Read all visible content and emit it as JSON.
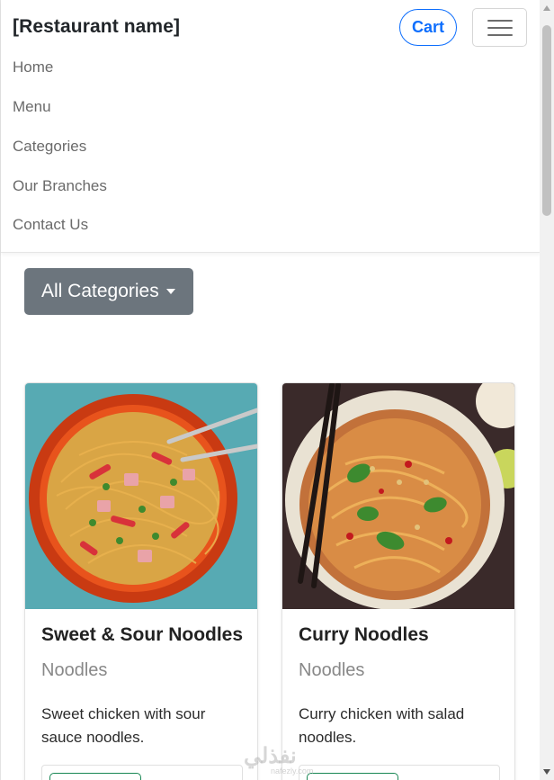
{
  "navbar": {
    "brand": "[Restaurant name]",
    "cart_label": "Cart",
    "toggler_icon": "hamburger-icon",
    "links": [
      "Home",
      "Menu",
      "Categories",
      "Our Branches",
      "Contact Us"
    ]
  },
  "filter": {
    "dropdown_label": "All Categories",
    "dropdown_icon": "caret-down-icon"
  },
  "products": [
    {
      "title": "Sweet & Sour Noodles",
      "category": "Noodles",
      "description": "Sweet chicken with sour sauce noodles."
    },
    {
      "title": "Curry Noodles",
      "category": "Noodles",
      "description": "Curry chicken with salad noodles."
    }
  ],
  "watermark": {
    "text": "نفذلي",
    "sub": "nafezly.com"
  },
  "colors": {
    "primary": "#0d6efd",
    "secondary": "#6c757d",
    "success": "#198754"
  }
}
